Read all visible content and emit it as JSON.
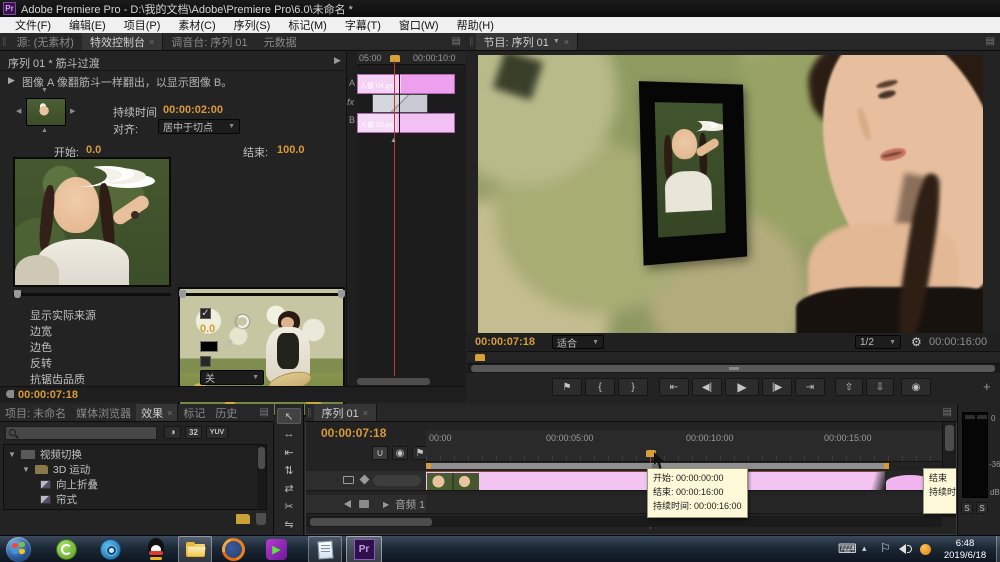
{
  "titlebar": {
    "app_initials": "Pr",
    "title": "Adobe Premiere Pro - D:\\我的文档\\Adobe\\Premiere Pro\\6.0\\未命名 *"
  },
  "menubar": {
    "items": [
      "文件(F)",
      "编辑(E)",
      "项目(P)",
      "素材(C)",
      "序列(S)",
      "标记(M)",
      "字幕(T)",
      "窗口(W)",
      "帮助(H)"
    ]
  },
  "panel_tabs": {
    "source": "源: (无素材)",
    "effect_controls": "特效控制台",
    "mixer": "调音台: 序列 01",
    "metadata": "元数据"
  },
  "effect_controls": {
    "header": "序列 01 * 筋斗过渡",
    "description": "图像 A 像翻筋斗一样翻出，以显示图像 B。",
    "duration_label": "持续时间",
    "duration_value": "00:00:02:00",
    "align_label": "对齐:",
    "align_value": "居中于切点",
    "start_label": "开始:",
    "start_value": "0.0",
    "end_label": "结束:",
    "end_value": "100.0",
    "show_actual_sources": "显示实际来源",
    "border_width_label": "边宽",
    "border_width_value": "0.0",
    "border_color_label": "边色",
    "reverse_label": "反转",
    "antialias_label": "抗锯齿品质",
    "antialias_value": "关",
    "current_time": "00:00:07:18",
    "timeline": {
      "ruler_start": "05:00",
      "ruler_end": "00:00:10:0",
      "track_a": "A",
      "fx": "fx",
      "track_b": "B",
      "clip_a": "人像 04.jpg",
      "clip_b": "人像 05.jpg"
    }
  },
  "program_monitor": {
    "tab": "节目: 序列 01",
    "current_time": "00:00:07:18",
    "zoom_level": "适合",
    "playback_resolution": "1/2",
    "total_duration": "00:00:16:00"
  },
  "project_panel": {
    "tabs": {
      "project": "项目: 未命名",
      "media_browser": "媒体浏览器",
      "effects": "效果",
      "markers": "标记",
      "history": "历史"
    },
    "badge_32": "32",
    "badge_yuv": "YUV",
    "tree": {
      "root": "视频切换",
      "folder": "3D 运动",
      "item1": "向上折叠",
      "item2": "帘式"
    }
  },
  "timeline": {
    "tab": "序列 01",
    "current_time": "00:00:07:18",
    "ruler": [
      "00:00",
      "00:00:05:00",
      "00:00:10:00",
      "00:00:15:00"
    ],
    "audio_track": "音频 1",
    "tooltip": {
      "line1": "开始: 00:00:00:00",
      "line2": "结束: 00:00:16:00",
      "line3": "持续时间: 00:00:16:00"
    },
    "tooltip_partial": {
      "line1": "结束",
      "line2": "持续时"
    }
  },
  "audio_meter": {
    "top": "0",
    "mid": "-36",
    "unit": "dB",
    "solo": "S"
  },
  "taskbar": {
    "time": "6:48",
    "date": "2019/6/18"
  },
  "icons": {
    "panel_menu": "▤",
    "close": "×",
    "dropdown": "▼",
    "collapse": "▶",
    "expand": "▼",
    "marker": "⚑",
    "mark_in": "{",
    "mark_out": "}",
    "go_in": "⇤",
    "step_back": "◀|",
    "play": "▶",
    "step_fwd": "|▶",
    "go_out": "⇥",
    "lift": "⇧",
    "extract": "⇩",
    "camera": "◉",
    "plus": "+",
    "wrench": "⚙",
    "snap": "∪",
    "chapter": "◉",
    "eyedropper": "✎",
    "keyboard": "⌨",
    "tray_up": "▴",
    "flag": "⚐",
    "tools": [
      "↖",
      "↔",
      "⇤",
      "⇅",
      "⇄",
      "✂",
      "⇋"
    ]
  }
}
